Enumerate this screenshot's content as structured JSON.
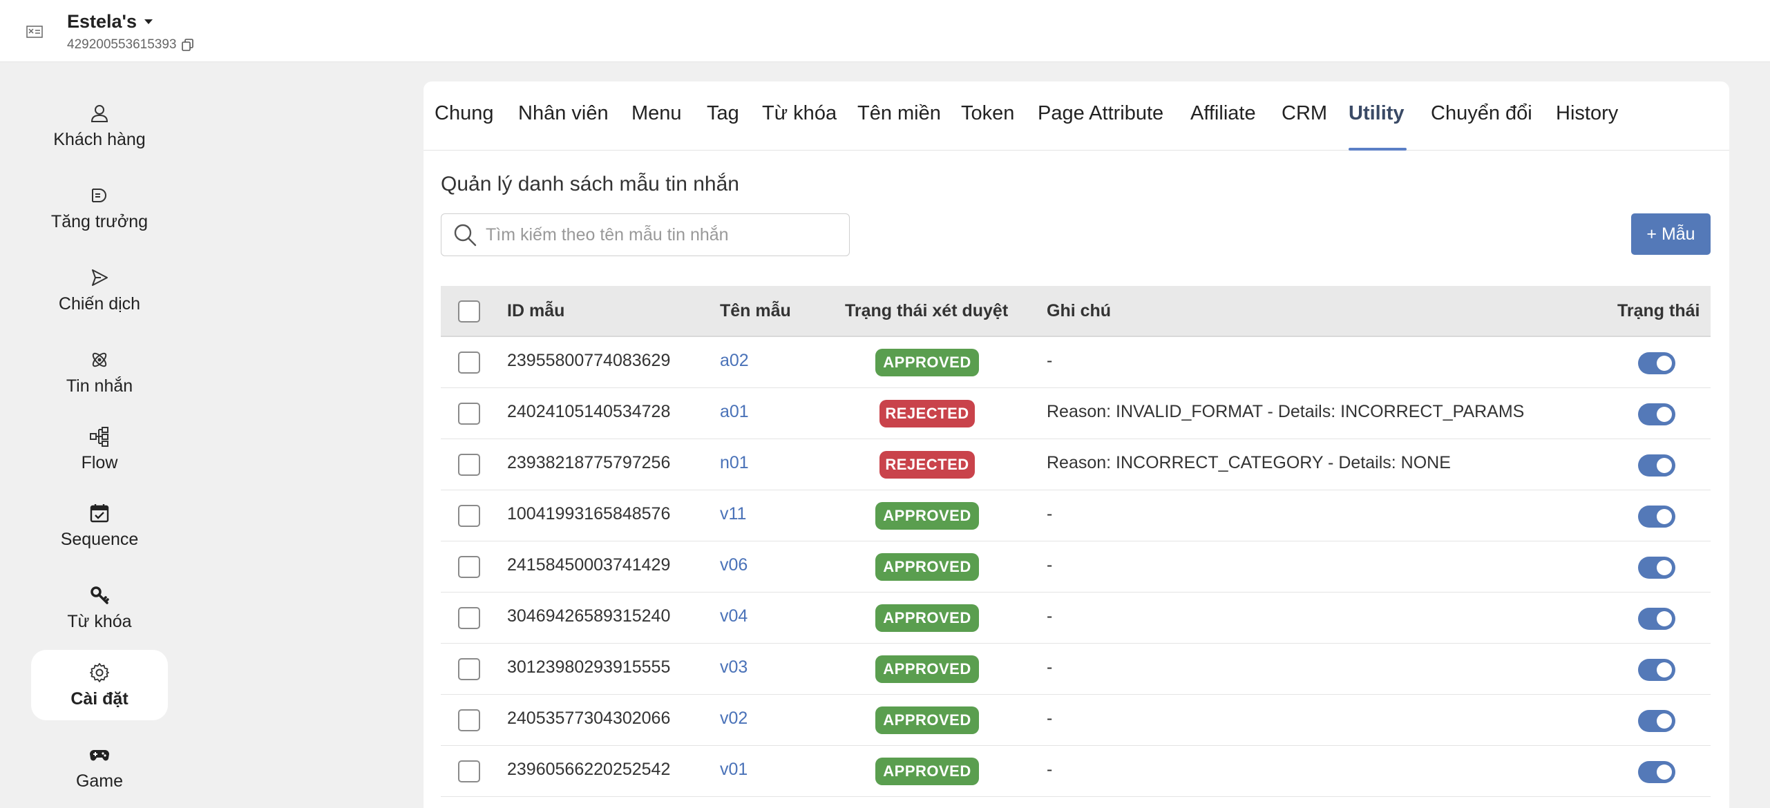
{
  "header": {
    "account_name": "Estela's",
    "account_id": "429200553615393"
  },
  "sidebar": {
    "items": [
      {
        "label": "Khách hàng",
        "icon": "user-icon"
      },
      {
        "label": "Tăng trưởng",
        "icon": "growth-icon"
      },
      {
        "label": "Chiến dịch",
        "icon": "send-icon"
      },
      {
        "label": "Tin nhắn",
        "icon": "message-atom-icon"
      },
      {
        "label": "Flow",
        "icon": "flow-icon"
      },
      {
        "label": "Sequence",
        "icon": "calendar-check-icon"
      },
      {
        "label": "Từ khóa",
        "icon": "key-icon"
      },
      {
        "label": "Cài đặt",
        "icon": "gear-icon"
      },
      {
        "label": "Game",
        "icon": "gamepad-icon"
      }
    ],
    "active": "Cài đặt"
  },
  "tabs": {
    "items": [
      "Chung",
      "Nhân viên",
      "Menu",
      "Tag",
      "Từ khóa",
      "Tên miền",
      "Token",
      "Page Attribute",
      "Affiliate",
      "CRM",
      "Utility",
      "Chuyển đổi",
      "History"
    ],
    "active": "Utility"
  },
  "main": {
    "title": "Quản lý danh sách mẫu tin nhắn",
    "search_placeholder": "Tìm kiếm theo tên mẫu tin nhắn",
    "add_button": "+ Mẫu"
  },
  "table": {
    "columns": [
      "ID mẫu",
      "Tên mẫu",
      "Trạng thái xét duyệt",
      "Ghi chú",
      "Trạng thái"
    ],
    "rows": [
      {
        "id": "23955800774083629",
        "name": "a02",
        "status": "APPROVED",
        "note": "-",
        "enabled": true
      },
      {
        "id": "24024105140534728",
        "name": "a01",
        "status": "REJECTED",
        "note": "Reason: INVALID_FORMAT - Details: INCORRECT_PARAMS",
        "enabled": true
      },
      {
        "id": "23938218775797256",
        "name": "n01",
        "status": "REJECTED",
        "note": "Reason: INCORRECT_CATEGORY - Details: NONE",
        "enabled": true
      },
      {
        "id": "10041993165848576",
        "name": "v11",
        "status": "APPROVED",
        "note": "-",
        "enabled": true
      },
      {
        "id": "24158450003741429",
        "name": "v06",
        "status": "APPROVED",
        "note": "-",
        "enabled": true
      },
      {
        "id": "30469426589315240",
        "name": "v04",
        "status": "APPROVED",
        "note": "-",
        "enabled": true
      },
      {
        "id": "30123980293915555",
        "name": "v03",
        "status": "APPROVED",
        "note": "-",
        "enabled": true
      },
      {
        "id": "24053577304302066",
        "name": "v02",
        "status": "APPROVED",
        "note": "-",
        "enabled": true
      },
      {
        "id": "23960566220252542",
        "name": "v01",
        "status": "APPROVED",
        "note": "-",
        "enabled": true
      }
    ]
  },
  "colors": {
    "accent": "#5479b8",
    "approved": "#5a9e4f",
    "rejected": "#c9434b"
  }
}
